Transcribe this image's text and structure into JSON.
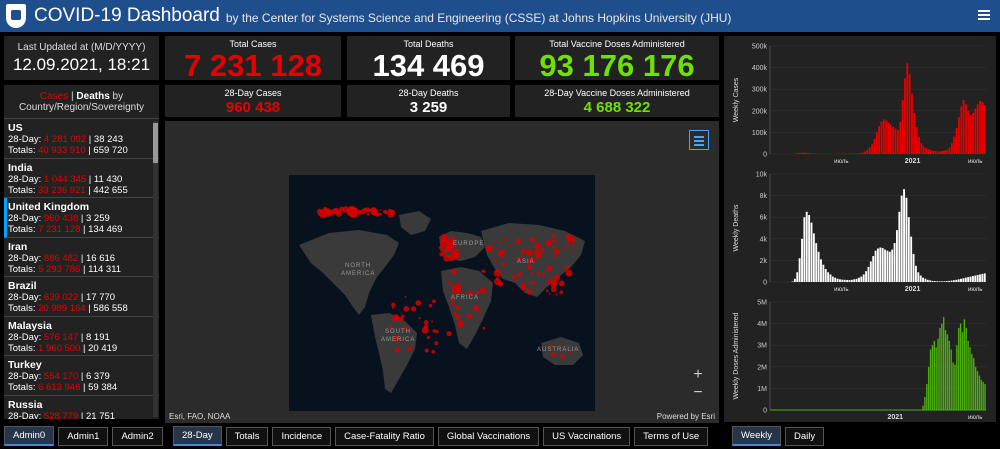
{
  "header": {
    "title": "COVID-19 Dashboard",
    "subtitle": "by the Center for Systems Science and Engineering (CSSE) at Johns Hopkins University (JHU)"
  },
  "last_updated": {
    "label": "Last Updated at (M/D/YYYY)",
    "value": "12.09.2021, 18:21"
  },
  "totals": {
    "cases": {
      "label": "Total Cases",
      "value": "7 231 128",
      "color": "#e60000"
    },
    "deaths": {
      "label": "Total Deaths",
      "value": "134 469",
      "color": "#ffffff"
    },
    "vaccines": {
      "label": "Total Vaccine Doses Administered",
      "value": "93 176 176",
      "color": "#70e000"
    }
  },
  "day28": {
    "cases": {
      "label": "28-Day Cases",
      "value": "960 438"
    },
    "deaths": {
      "label": "28-Day Deaths",
      "value": "3 259"
    },
    "vaccines": {
      "label": "28-Day Vaccine Doses Administered",
      "value": "4 688 322"
    }
  },
  "list": {
    "head_cases": "Cases",
    "head_sep": " | ",
    "head_deaths": "Deaths",
    "head_by": " by",
    "head_line2": "Country/Region/Sovereignty",
    "day_prefix": "28-Day: ",
    "totals_prefix": "Totals: ",
    "sep": " | ",
    "items": [
      {
        "name": "US",
        "d28_cases": "4 281 092",
        "d28_deaths": "38 243",
        "t_cases": "40 933 910",
        "t_deaths": "659 720"
      },
      {
        "name": "India",
        "d28_cases": "1 044 345",
        "d28_deaths": "11 430",
        "t_cases": "33 236 921",
        "t_deaths": "442 655"
      },
      {
        "name": "United Kingdom",
        "d28_cases": "960 438",
        "d28_deaths": "3 259",
        "t_cases": "7 231 128",
        "t_deaths": "134 469"
      },
      {
        "name": "Iran",
        "d28_cases": "886 482",
        "d28_deaths": "16 616",
        "t_cases": "5 293 786",
        "t_deaths": "114 311"
      },
      {
        "name": "Brazil",
        "d28_cases": "639 022",
        "d28_deaths": "17 770",
        "t_cases": "20 989 164",
        "t_deaths": "586 558"
      },
      {
        "name": "Malaysia",
        "d28_cases": "576 147",
        "d28_deaths": "8 191",
        "t_cases": "1 960 500",
        "t_deaths": "20 419"
      },
      {
        "name": "Turkey",
        "d28_cases": "554 170",
        "d28_deaths": "6 379",
        "t_cases": "6 613 946",
        "t_deaths": "59 384"
      },
      {
        "name": "Russia",
        "d28_cases": "528 779",
        "d28_deaths": "21 751",
        "t_cases": "",
        "t_deaths": ""
      }
    ]
  },
  "map": {
    "attribution_left": "Esri, FAO, NOAA",
    "attribution_right": "Powered by Esri",
    "zoom_in": "+",
    "zoom_out": "−",
    "labels": {
      "north": "NORTH",
      "america": "AMERICA",
      "south": "SOUTH",
      "south_america": "AMERICA",
      "europe": "EUROPE",
      "asia": "ASIA",
      "africa": "AFRICA",
      "australia": "AUSTRALIA"
    }
  },
  "tabs_left": [
    "Admin0",
    "Admin1",
    "Admin2"
  ],
  "tabs_mid": [
    "28-Day",
    "Totals",
    "Incidence",
    "Case-Fatality Ratio",
    "Global Vaccinations",
    "US Vaccinations",
    "Terms of Use"
  ],
  "tabs_right": [
    "Weekly",
    "Daily"
  ],
  "colors": {
    "cases": "#e60000",
    "deaths": "#ffffff",
    "vaccines": "#4caf10",
    "header": "#1f4e8c"
  },
  "chart_data": [
    {
      "type": "bar",
      "ylabel": "Weekly Cases",
      "yticks": [
        "0",
        "100k",
        "200k",
        "300k",
        "400k",
        "500k"
      ],
      "ylim": [
        0,
        500000
      ],
      "xticks": [
        "июль",
        "2021",
        "июль"
      ],
      "color": "#e60000",
      "values": [
        0,
        0,
        0,
        0,
        0,
        0,
        0,
        0,
        0,
        500,
        1500,
        3500,
        5000,
        6000,
        5500,
        4800,
        4000,
        3200,
        2600,
        2000,
        1500,
        1200,
        1000,
        900,
        800,
        700,
        600,
        600,
        700,
        800,
        900,
        1000,
        1100,
        1300,
        1600,
        2000,
        2600,
        3400,
        4800,
        7000,
        12000,
        20000,
        30000,
        45000,
        70000,
        100000,
        130000,
        150000,
        160000,
        155000,
        145000,
        135000,
        125000,
        118000,
        112000,
        150000,
        250000,
        350000,
        420000,
        370000,
        280000,
        190000,
        125000,
        80000,
        50000,
        35000,
        28000,
        22000,
        18000,
        15000,
        14000,
        13000,
        13000,
        14000,
        16000,
        20000,
        30000,
        50000,
        80000,
        120000,
        170000,
        220000,
        250000,
        230000,
        200000,
        180000,
        190000,
        210000,
        230000,
        245000,
        240000,
        225000
      ]
    },
    {
      "type": "bar",
      "ylabel": "Weekly Deaths",
      "yticks": [
        "0",
        "2k",
        "4k",
        "6k",
        "8k",
        "10k"
      ],
      "ylim": [
        0,
        10000
      ],
      "xticks": [
        "июль",
        "2021",
        "июль"
      ],
      "color": "#ffffff",
      "values": [
        0,
        0,
        0,
        0,
        0,
        0,
        0,
        0,
        0,
        50,
        300,
        900,
        2200,
        4000,
        6000,
        6500,
        6200,
        5500,
        4500,
        3600,
        2800,
        2100,
        1600,
        1200,
        900,
        700,
        500,
        400,
        300,
        250,
        220,
        200,
        190,
        180,
        200,
        250,
        300,
        400,
        500,
        700,
        1000,
        1400,
        1900,
        2400,
        2900,
        3100,
        3200,
        3150,
        3000,
        2900,
        2800,
        3000,
        3600,
        4800,
        6500,
        8000,
        8600,
        7800,
        6000,
        4200,
        2600,
        1500,
        900,
        600,
        400,
        300,
        200,
        150,
        100,
        80,
        70,
        60,
        60,
        70,
        80,
        100,
        130,
        160,
        200,
        250,
        300,
        350,
        400,
        450,
        500,
        550,
        600,
        650,
        700,
        750,
        800
      ]
    },
    {
      "type": "bar",
      "ylabel": "Weekly Doses Administered",
      "yticks": [
        "0",
        "1M",
        "2M",
        "3M",
        "4M",
        "5M"
      ],
      "ylim": [
        0,
        5000000
      ],
      "xticks": [
        "2021",
        "июль"
      ],
      "color": "#4caf10",
      "values": [
        0,
        0,
        0,
        0,
        0,
        0,
        0,
        0,
        0,
        0,
        0,
        0,
        0,
        0,
        0,
        0,
        0,
        0,
        0,
        0,
        0,
        0,
        0,
        0,
        0,
        0,
        0,
        0,
        0,
        0,
        0,
        0,
        0,
        0,
        0,
        0,
        0,
        0,
        0,
        0,
        0,
        0,
        0,
        0,
        0,
        0,
        0,
        0,
        0,
        0,
        0,
        0,
        0,
        0,
        0,
        0,
        0,
        0,
        0,
        0,
        0,
        0,
        0,
        0,
        0,
        0,
        0,
        0,
        0,
        0,
        0,
        0,
        0,
        0,
        0,
        0,
        0,
        0,
        0,
        0,
        0,
        200000,
        600000,
        1200000,
        2000000,
        2800000,
        3000000,
        3200000,
        2900000,
        3300000,
        3800000,
        4000000,
        4300000,
        3700000,
        3500000,
        3200000,
        2800000,
        2200000,
        2100000,
        3000000,
        3800000,
        4000000,
        3600000,
        4200000,
        3800000,
        3200000,
        2900000,
        2600000,
        2400000,
        2000000,
        1800000,
        1600000,
        1400000,
        1300000,
        1200000
      ]
    }
  ]
}
